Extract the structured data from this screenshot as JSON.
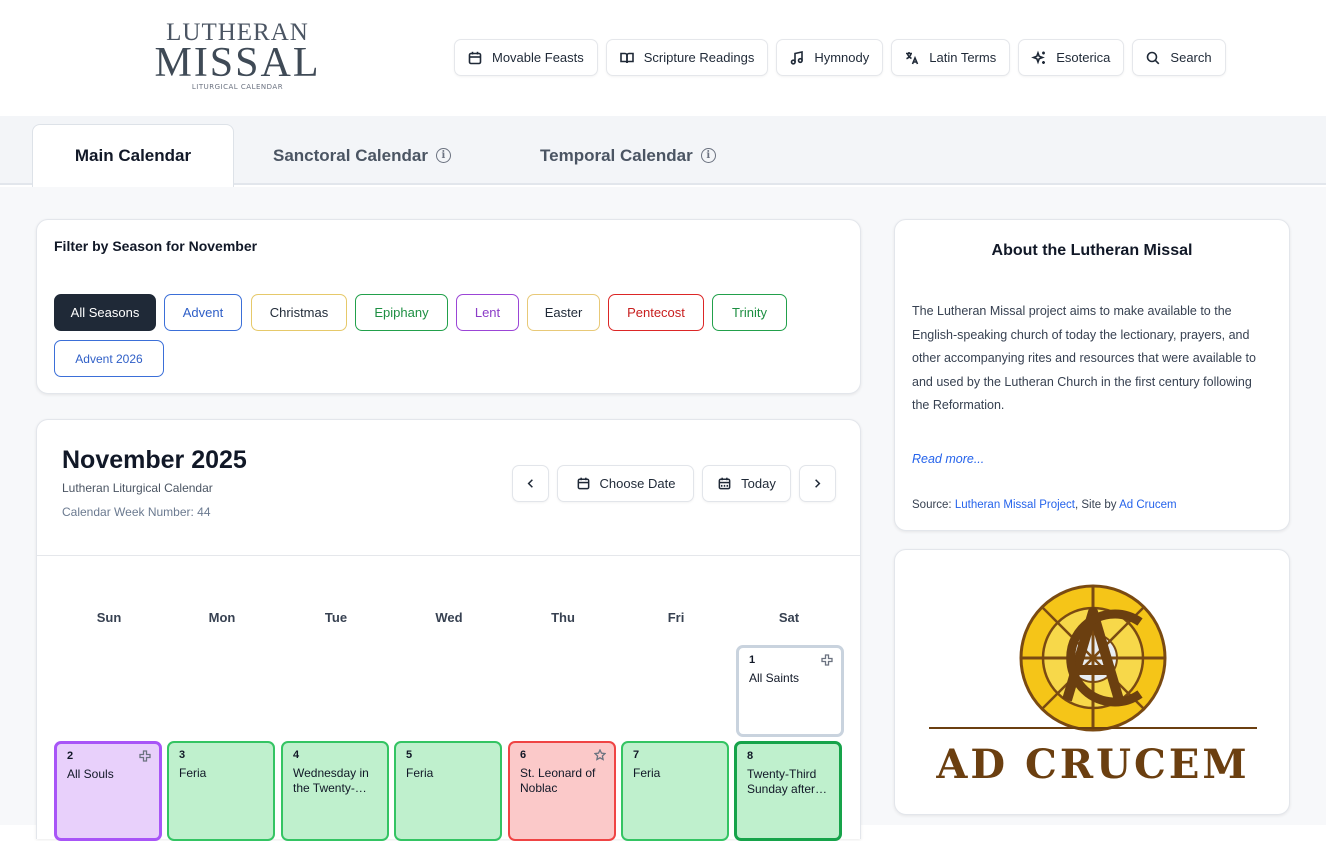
{
  "logo": {
    "line1": "LUTHERAN",
    "line2": "MISSAL",
    "line3": "LITURGICAL CALENDAR"
  },
  "topnav": [
    {
      "label": "Movable Feasts",
      "icon": "calendar-icon"
    },
    {
      "label": "Scripture Readings",
      "icon": "book-open-icon"
    },
    {
      "label": "Hymnody",
      "icon": "music-note-icon"
    },
    {
      "label": "Latin Terms",
      "icon": "translate-icon"
    },
    {
      "label": "Esoterica",
      "icon": "sparkles-icon"
    },
    {
      "label": "Search",
      "icon": "search-icon"
    }
  ],
  "tabs": [
    {
      "label": "Main Calendar",
      "active": true
    },
    {
      "label": "Sanctoral Calendar",
      "info": true
    },
    {
      "label": "Temporal Calendar",
      "info": true
    }
  ],
  "filter": {
    "title": "Filter by Season for November",
    "chips": [
      {
        "label": "All Seasons",
        "color": "#1f2937",
        "selected": true
      },
      {
        "label": "Advent",
        "color": "#3b6fd8"
      },
      {
        "label": "Christmas",
        "color": "#e6c96a"
      },
      {
        "label": "Epiphany",
        "color": "#22a04b"
      },
      {
        "label": "Lent",
        "color": "#9b45d6"
      },
      {
        "label": "Easter",
        "color": "#e8c978"
      },
      {
        "label": "Pentecost",
        "color": "#dc2626"
      },
      {
        "label": "Trinity",
        "color": "#22a04b"
      },
      {
        "label": "Advent 2026",
        "color": "#3b6fd8"
      }
    ]
  },
  "calendar": {
    "title": "November 2025",
    "subtitle": "Lutheran Liturgical Calendar",
    "week": "Calendar Week Number: 44",
    "prev_label": "‹",
    "choose_label": "Choose Date",
    "today_label": "Today",
    "next_label": "›",
    "weekdays": [
      "Sun",
      "Mon",
      "Tue",
      "Wed",
      "Thu",
      "Fri",
      "Sat"
    ],
    "days": [
      {
        "num": "1",
        "feast": "All Saints",
        "col": 6,
        "row": 0,
        "style": "white",
        "icon": "cross-icon"
      },
      {
        "num": "2",
        "feast": "All Souls",
        "col": 0,
        "row": 1,
        "style": "purple",
        "icon": "cross-icon"
      },
      {
        "num": "3",
        "feast": "Feria",
        "col": 1,
        "row": 1,
        "style": "green"
      },
      {
        "num": "4",
        "feast": "Wednesday in the Twenty-…",
        "col": 2,
        "row": 1,
        "style": "green"
      },
      {
        "num": "5",
        "feast": "Feria",
        "col": 3,
        "row": 1,
        "style": "green"
      },
      {
        "num": "6",
        "feast": "St. Leonard of Noblac",
        "col": 4,
        "row": 1,
        "style": "red",
        "icon": "star-icon"
      },
      {
        "num": "7",
        "feast": "Feria",
        "col": 5,
        "row": 1,
        "style": "green"
      },
      {
        "num": "8",
        "feast": "Twenty-Third Sunday after…",
        "col": 6,
        "row": 1,
        "style": "green-strong"
      }
    ]
  },
  "about": {
    "title": "About the Lutheran Missal",
    "text": "The Lutheran Missal project aims to make available to the English-speaking church of today the lectionary, prayers, and other accompanying rites and resources that were available to and used by the Lutheran Church in the first century following the Reformation.",
    "read_more": "Read more...",
    "source_prefix": "Source: ",
    "source_link": "Lutheran Missal Project",
    "site_by": ", Site by ",
    "site_link": "Ad Crucem"
  },
  "ad": {
    "label": "AD CRUCEM"
  }
}
